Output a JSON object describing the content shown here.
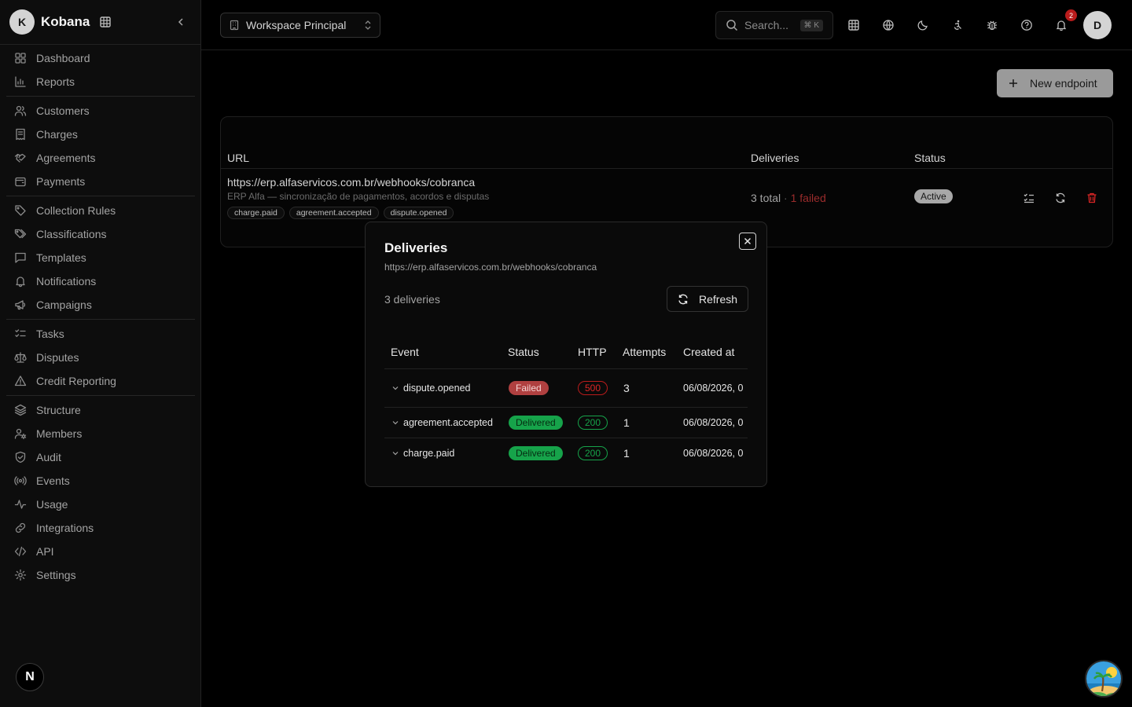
{
  "brand": {
    "initial": "K",
    "name": "Kobana"
  },
  "sidebar": {
    "groups": [
      [
        {
          "label": "Dashboard",
          "icon": "dashboard-icon"
        },
        {
          "label": "Reports",
          "icon": "bar-chart-icon"
        }
      ],
      [
        {
          "label": "Customers",
          "icon": "users-icon"
        },
        {
          "label": "Charges",
          "icon": "receipt-icon"
        },
        {
          "label": "Agreements",
          "icon": "handshake-icon"
        },
        {
          "label": "Payments",
          "icon": "wallet-icon"
        }
      ],
      [
        {
          "label": "Collection Rules",
          "icon": "tag-icon"
        },
        {
          "label": "Classifications",
          "icon": "tags-icon"
        },
        {
          "label": "Templates",
          "icon": "message-square-icon"
        },
        {
          "label": "Notifications",
          "icon": "bell-icon"
        },
        {
          "label": "Campaigns",
          "icon": "megaphone-icon"
        }
      ],
      [
        {
          "label": "Tasks",
          "icon": "list-checks-icon"
        },
        {
          "label": "Disputes",
          "icon": "scale-icon"
        },
        {
          "label": "Credit Reporting",
          "icon": "alert-triangle-icon"
        }
      ],
      [
        {
          "label": "Structure",
          "icon": "layers-icon"
        },
        {
          "label": "Members",
          "icon": "user-cog-icon"
        },
        {
          "label": "Audit",
          "icon": "shield-check-icon"
        },
        {
          "label": "Events",
          "icon": "radio-icon"
        },
        {
          "label": "Usage",
          "icon": "activity-icon"
        },
        {
          "label": "Integrations",
          "icon": "link-icon"
        },
        {
          "label": "API",
          "icon": "code-icon"
        },
        {
          "label": "Settings",
          "icon": "gear-icon"
        }
      ]
    ],
    "next_badge": "N"
  },
  "topbar": {
    "workspace": "Workspace Principal",
    "search_placeholder": "Search...",
    "search_shortcut": "⌘ K",
    "notification_count": "2",
    "user_initial": "D"
  },
  "main": {
    "new_endpoint_label": "New endpoint",
    "table_headers": {
      "url": "URL",
      "deliveries": "Deliveries",
      "status": "Status"
    },
    "endpoint": {
      "url": "https://erp.alfaservicos.com.br/webhooks/cobranca",
      "description": "ERP Alfa — sincronização de pagamentos, acordos e disputas",
      "tags": [
        "charge.paid",
        "agreement.accepted",
        "dispute.opened"
      ],
      "deliveries_total": "3 total",
      "deliveries_sep": " · ",
      "deliveries_failed": "1 failed",
      "status": "Active"
    }
  },
  "modal": {
    "title": "Deliveries",
    "subtitle": "https://erp.alfaservicos.com.br/webhooks/cobranca",
    "count_text": "3 deliveries",
    "refresh_label": "Refresh",
    "headers": {
      "event": "Event",
      "status": "Status",
      "http": "HTTP",
      "attempts": "Attempts",
      "created_at": "Created at"
    },
    "rows": [
      {
        "event": "dispute.opened",
        "status": "Failed",
        "http": "500",
        "attempts": "3",
        "created_at": "06/08/2026, 0"
      },
      {
        "event": "agreement.accepted",
        "status": "Delivered",
        "http": "200",
        "attempts": "1",
        "created_at": "06/08/2026, 0"
      },
      {
        "event": "charge.paid",
        "status": "Delivered",
        "http": "200",
        "attempts": "1",
        "created_at": "06/08/2026, 0"
      }
    ]
  },
  "colors": {
    "failed": "#b04040",
    "delivered": "#16a34a",
    "accent_muted": "#9a9a9a"
  }
}
